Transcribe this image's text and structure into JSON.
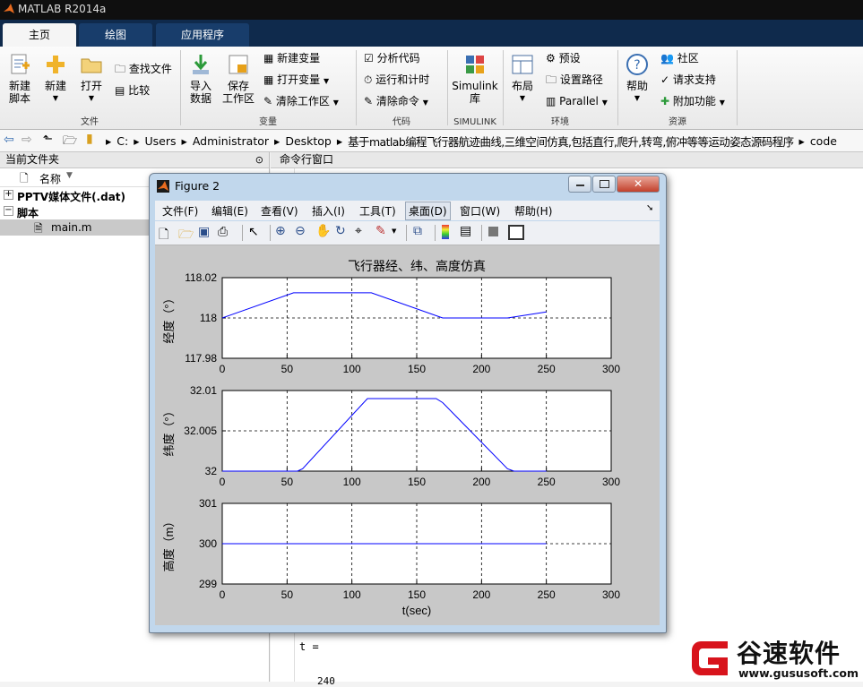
{
  "window": {
    "title": "MATLAB R2014a"
  },
  "tabs": [
    {
      "label": "主页"
    },
    {
      "label": "绘图"
    },
    {
      "label": "应用程序"
    }
  ],
  "ribbon": {
    "new_script": "新建\n脚本",
    "new": "新建",
    "open": "打开",
    "find_files": "查找文件",
    "compare": "比较",
    "import": "导入\n数据",
    "save_ws": "保存\n工作区",
    "new_var": "新建变量",
    "open_var": "打开变量",
    "clear_ws": "清除工作区",
    "analyze": "分析代码",
    "run_time": "运行和计时",
    "clear_cmd": "清除命令",
    "simulink": "Simulink\n库",
    "layout": "布局",
    "prefs": "预设",
    "set_path": "设置路径",
    "parallel": "Parallel",
    "help": "帮助",
    "community": "社区",
    "support": "请求支持",
    "addons": "附加功能",
    "sections": {
      "file": "文件",
      "variable": "变量",
      "code": "代码",
      "simulink": "SIMULINK",
      "env": "环境",
      "resources": "资源"
    }
  },
  "address": {
    "crumbs": [
      "C:",
      "Users",
      "Administrator",
      "Desktop",
      "基于matlab编程飞行器航迹曲线,三维空间仿真,包括直行,爬升,转弯,俯冲等等运动姿态源码程序",
      "code"
    ]
  },
  "left_panel": {
    "title": "当前文件夹",
    "col_name": "名称",
    "items": [
      {
        "label": "PPTV媒体文件(.dat)",
        "expanded": false
      },
      {
        "label": "脚本",
        "expanded": true
      },
      {
        "label": "main.m",
        "selected": true
      }
    ]
  },
  "cmd_panel": {
    "title": "命令行窗口",
    "line1": "t =",
    "line2": "240"
  },
  "figure": {
    "title": "Figure 2",
    "menus": [
      "文件(F)",
      "编辑(E)",
      "查看(V)",
      "插入(I)",
      "工具(T)",
      "桌面(D)",
      "窗口(W)",
      "帮助(H)"
    ]
  },
  "watermark": {
    "brand": "谷速软件",
    "url": "www.gususoft.com",
    "color": "#d8141c"
  },
  "chart_data": [
    {
      "type": "line",
      "title": "飞行器经、纬、高度仿真",
      "ylabel": "经度（°）",
      "xlabel": "",
      "xlim": [
        0,
        300
      ],
      "ylim": [
        117.98,
        118.02
      ],
      "xticks": [
        "0",
        "50",
        "100",
        "150",
        "200",
        "250",
        "300"
      ],
      "yticks": [
        "117.98",
        "118",
        "118.02"
      ],
      "grid": true,
      "series": [
        {
          "x": [
            0,
            55,
            115,
            170,
            220,
            250
          ],
          "y": [
            118.0,
            118.0125,
            118.0125,
            118.0,
            118.0,
            118.003
          ]
        }
      ]
    },
    {
      "type": "line",
      "title": "",
      "ylabel": "纬度（°）",
      "xlabel": "",
      "xlim": [
        0,
        300
      ],
      "ylim": [
        32,
        32.01
      ],
      "xticks": [
        "0",
        "50",
        "100",
        "150",
        "200",
        "250",
        "300"
      ],
      "yticks": [
        "32",
        "32.005",
        "32.01"
      ],
      "grid": true,
      "series": [
        {
          "x": [
            0,
            58,
            62,
            112,
            165,
            170,
            220,
            225,
            250
          ],
          "y": [
            32.0,
            32.0,
            32.0003,
            32.009,
            32.009,
            32.0085,
            32.0003,
            32.0,
            32.0
          ]
        }
      ]
    },
    {
      "type": "line",
      "title": "",
      "ylabel": "高度（m）",
      "xlabel": "t(sec)",
      "xlim": [
        0,
        300
      ],
      "ylim": [
        299,
        301
      ],
      "xticks": [
        "0",
        "50",
        "100",
        "150",
        "200",
        "250",
        "300"
      ],
      "yticks": [
        "299",
        "300",
        "301"
      ],
      "grid": true,
      "series": [
        {
          "x": [
            0,
            250
          ],
          "y": [
            300,
            300
          ]
        }
      ]
    }
  ]
}
